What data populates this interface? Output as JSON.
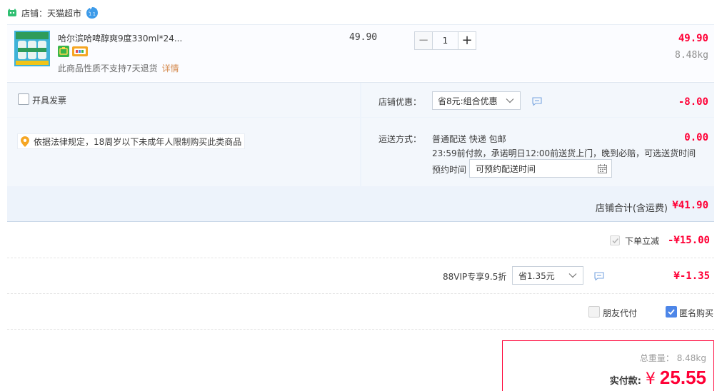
{
  "store": {
    "name": "店铺：天猫超市",
    "icon": "tmall-cat-icon",
    "service_icon": "customer-service-icon"
  },
  "item": {
    "title": "哈尔滨哈啤醇爽9度330ml*24...",
    "unit_price": "49.90",
    "quantity": "1",
    "minus_label": "−",
    "plus_label": "+",
    "total": "49.90",
    "weight": "8.48kg",
    "note": "此商品性质不支持7天退货",
    "note_link": "详情",
    "badges": [
      "credit-card-icon",
      "installment-icon"
    ]
  },
  "invoice": {
    "label": "开具发票",
    "checked": false
  },
  "law_notice": "依据法律规定，18周岁以下未成年人限制购买此类商品",
  "store_discount": {
    "label": "店铺优惠：",
    "selected": "省8元:组合优惠",
    "value": "-8.00"
  },
  "shipping": {
    "label": "运送方式：",
    "method": "普通配送 快递 包邮",
    "promise": "23:59前付款，承诺明日12:00前送货上门，晚到必赔，可选送货时间",
    "value": "0.00",
    "schedule_label": "预约时间",
    "schedule_placeholder": "可预约配送时间"
  },
  "store_total": {
    "label": "店铺合计(含运费)",
    "value": "¥41.90"
  },
  "instant_discount": {
    "label": "下单立减",
    "value": "-¥15.00",
    "checked": true
  },
  "vip": {
    "label": "88VIP专享9.5折",
    "selected": "省1.35元",
    "value": "¥-1.35"
  },
  "options": {
    "friend_pay": {
      "label": "朋友代付",
      "checked": false
    },
    "anonymous": {
      "label": "匿名购买",
      "checked": true
    }
  },
  "pay": {
    "weight_label": "总重量： 8.48kg",
    "label": "实付款:",
    "currency": "¥",
    "value": "25.55"
  },
  "colors": {
    "price_red": "#ff0036",
    "panel_bg": "#edf3fb",
    "check_blue": "#4d86e8"
  }
}
